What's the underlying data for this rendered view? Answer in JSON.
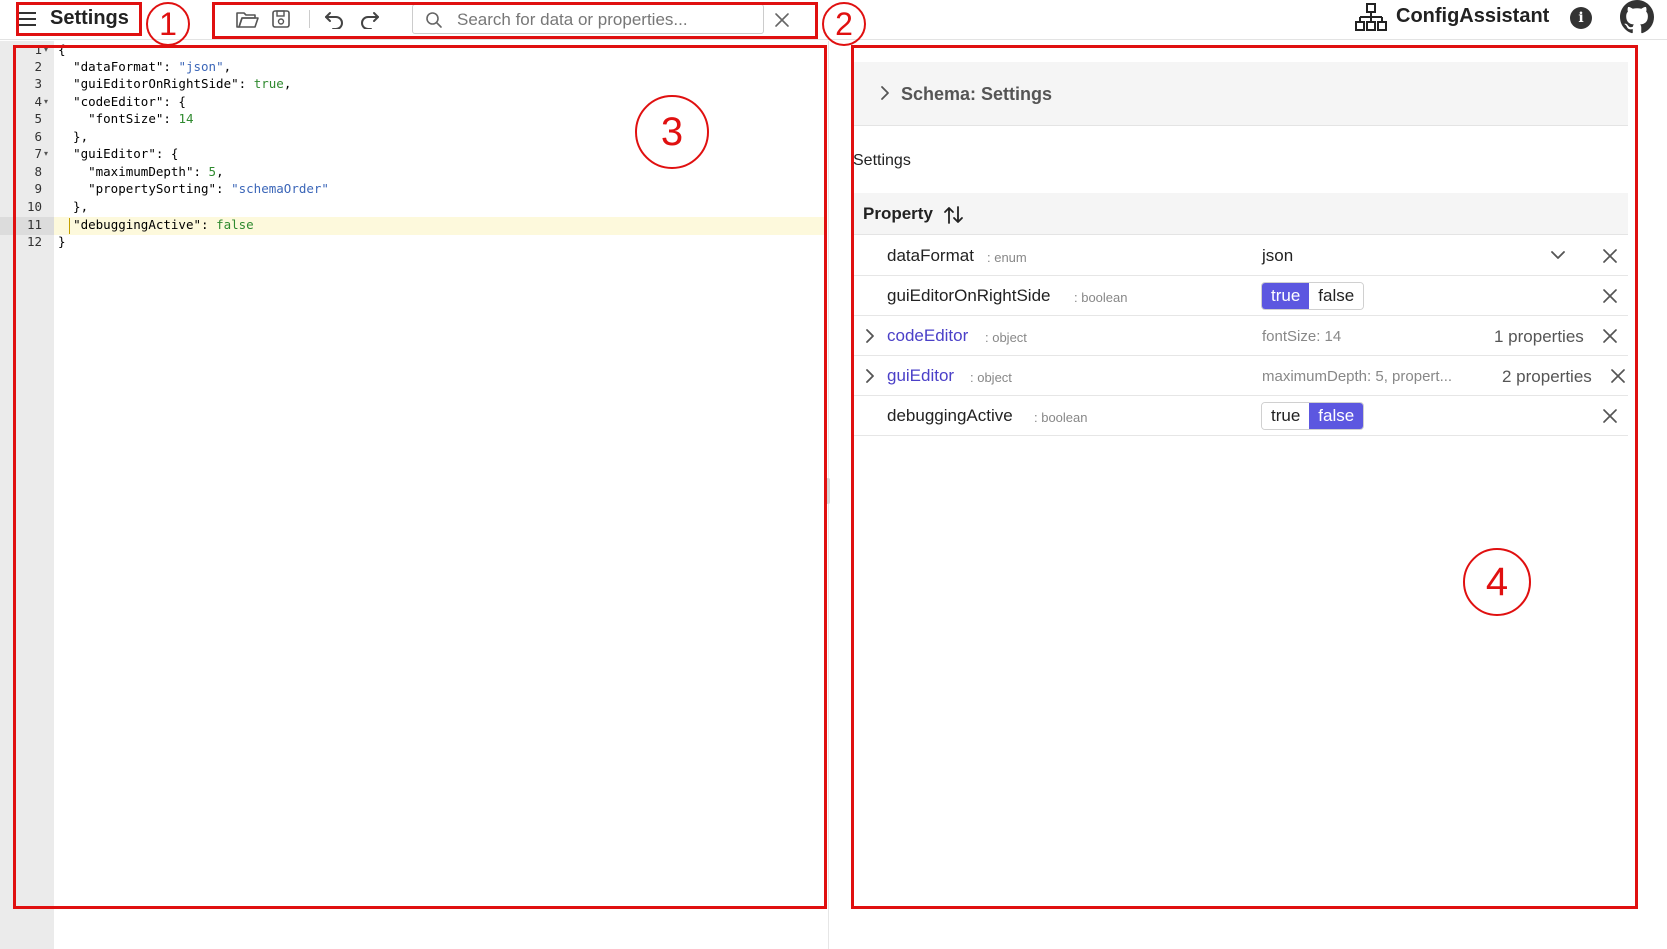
{
  "header": {
    "title": "Settings",
    "search_placeholder": "Search for data or properties...",
    "brand": "ConfigAssistant"
  },
  "editor": {
    "line_numbers": [
      "1",
      "2",
      "3",
      "4",
      "5",
      "6",
      "7",
      "8",
      "9",
      "10",
      "11",
      "12"
    ],
    "active_line": 11
  },
  "gui": {
    "schema_title": "Schema: Settings",
    "section_label": "Settings",
    "property_header": "Property",
    "rows": [
      {
        "name": "dataFormat",
        "type": ": enum",
        "value": "json"
      },
      {
        "name": "guiEditorOnRightSide",
        "type": ": boolean",
        "true_label": "true",
        "false_label": "false",
        "selected": "true"
      },
      {
        "name": "codeEditor",
        "type": ": object",
        "preview": "fontSize: 14",
        "count": "1 properties"
      },
      {
        "name": "guiEditor",
        "type": ": object",
        "preview": "maximumDepth: 5, propert...",
        "count": "2 properties"
      },
      {
        "name": "debuggingActive",
        "type": ": boolean",
        "true_label": "true",
        "false_label": "false",
        "selected": "false"
      }
    ]
  },
  "annotations": [
    "1",
    "2",
    "3",
    "4"
  ],
  "colors": {
    "accent": "#5c57e0",
    "annotation": "#e01010",
    "object_link": "#4b40c8"
  }
}
